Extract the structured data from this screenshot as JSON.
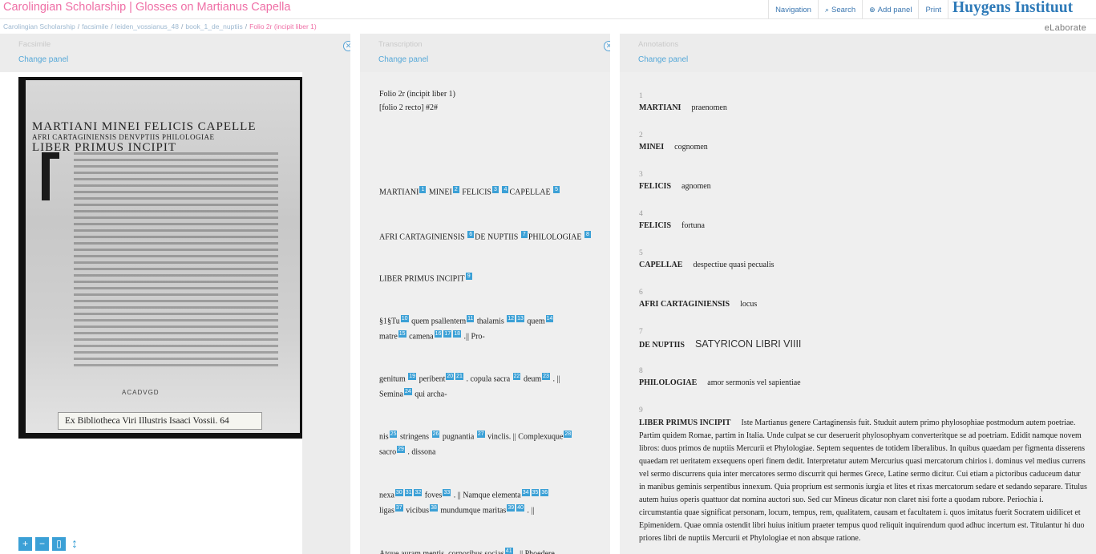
{
  "app_title": "Carolingian Scholarship | Glosses on Martianus Capella",
  "nav": {
    "navigation": "Navigation",
    "search": "Search",
    "add_panel": "Add panel",
    "print": "Print",
    "search_icon": "magnifier-icon",
    "add_icon": "plus-circle-icon"
  },
  "brand": "Huygens Instituut",
  "brand_sub": "eLaborate",
  "breadcrumb": [
    "Carolingian Scholarship",
    "facsimile",
    "leiden_vossianus_48",
    "book_1_de_nuptiis",
    "Folio 2r (incipit liber 1)"
  ],
  "panels": {
    "facsimile": {
      "title": "Facsimile",
      "change": "Change panel",
      "ms_heading": "MARTIANI MINEI FELICIS CAPELLE",
      "ms_heading2": "AFRI CARTAGINIENSIS DENVPTIIS PHILOLOGIAE",
      "ms_heading3": "LIBER PRIMUS INCIPIT",
      "ms_stamp": "ACADVGD",
      "ex_label": "Ex Bibliotheca Viri Illustris Isaaci Vossii. 64"
    },
    "transcription": {
      "title": "Transcription",
      "change": "Change panel",
      "header1": "Folio 2r (incipit liber 1)",
      "header2": "[folio 2 recto] #2#"
    },
    "annotations": {
      "title": "Annotations",
      "change": "Change panel"
    }
  },
  "annotations": [
    {
      "n": "1",
      "term": "MARTIANI",
      "text": "praenomen"
    },
    {
      "n": "2",
      "term": "MINEI",
      "text": "cognomen"
    },
    {
      "n": "3",
      "term": "FELICIS",
      "text": "agnomen"
    },
    {
      "n": "4",
      "term": "FELICIS",
      "text": "fortuna"
    },
    {
      "n": "5",
      "term": "CAPELLAE",
      "text": "despectiue quasi pecualis"
    },
    {
      "n": "6",
      "term": "AFRI CARTAGINIENSIS",
      "text": "locus"
    },
    {
      "n": "7",
      "term": "DE NUPTIIS",
      "text": "SATYRICON LIBRI VIIII"
    },
    {
      "n": "8",
      "term": "PHILOLOGIAE",
      "text": "amor sermonis vel sapientiae"
    },
    {
      "n": "9",
      "term": "LIBER PRIMUS INCIPIT",
      "text": "Iste Martianus genere Cartaginensis fuit. Studuit autem primo phylosophiae postmodum autem poetriae. Partim quidem Romae, partim in Italia. Unde culpat se cur deseruerit phylosophyam converteritque se ad poetriam. Edidit namque novem libros: duos primos de nuptiis Mercurii et Phylologiae. Septem sequentes de totidem liberalibus. In quibus quaedam per figmenta disserens quaedam ret ueritatem exsequens operi finem dedit. Interpretatur autem Mercurius quasi mercatorum chirios i. dominus vel medius currens vel sermo discurrens quia inter mercatores sermo discurrit qui hermes Grece, Latine sermo dicitur. Cui etiam a pictoribus caduceum datur in manibus geminis serpentibus innexum. Quia proprium est sermonis iurgia et lites et rixas mercatorum sedare et sedando separare. Titulus autem huius operis quattuor dat nomina auctori suo. Sed cur Mineus dicatur non claret nisi forte a quodam rubore. Periochia i. circumstantia quae significat personam, locum, tempus, rem, qualitatem, causam et facultatem i. quos imitatus fuerit Socratem uidilicet et Epimenidem. Quae omnia ostendit libri huius initium praeter tempus quod reliquit inquirendum quod adhuc incertum est. Titulantur hi duo priores libri de nuptiis Mercurii et Phylologiae et non absque ratione."
    }
  ],
  "transcription_lines": [
    {
      "segments": [
        [
          "MARTIANI",
          [
            "1"
          ]
        ],
        [
          " MINEI",
          [
            "2"
          ]
        ],
        [
          " FELICIS",
          [
            "3"
          ]
        ],
        [
          " ",
          [
            "4"
          ]
        ],
        [
          "CAPELLAE ",
          [
            "5"
          ]
        ]
      ]
    },
    {
      "segments": [
        [
          "AFRI CARTAGINIENSIS ",
          [
            "6"
          ]
        ],
        [
          "DE NUPTIIS ",
          [
            "7"
          ]
        ],
        [
          "PHILOLOGIAE ",
          [
            "8"
          ]
        ]
      ]
    },
    {
      "segments": [
        [
          "LIBER PRIMUS INCIPIT",
          [
            "9"
          ]
        ]
      ]
    },
    {
      "segments": [
        [
          "§1§Tu",
          [
            "10"
          ]
        ],
        [
          " quem psallentem",
          [
            "11"
          ]
        ],
        [
          " thalamis ",
          [
            "12",
            "13"
          ]
        ],
        [
          " quem",
          [
            "14"
          ]
        ]
      ]
    },
    {
      "segments": [
        [
          "matre",
          [
            "15"
          ]
        ],
        [
          " camena",
          [
            "16",
            "17",
            "18"
          ]
        ],
        [
          " .|| Pro-",
          []
        ]
      ]
    },
    {
      "segments": [
        [
          "genitum ",
          [
            "19"
          ]
        ],
        [
          " peribent",
          [
            "20",
            "21"
          ]
        ],
        [
          " . copula sacra ",
          [
            "22"
          ]
        ],
        [
          " deum",
          [
            "23"
          ]
        ],
        [
          " . ||",
          []
        ]
      ]
    },
    {
      "segments": [
        [
          "Semina",
          [
            "24"
          ]
        ],
        [
          " qui archa-",
          []
        ]
      ]
    },
    {
      "segments": [
        [
          "nis",
          [
            "25"
          ]
        ],
        [
          " stringens ",
          [
            "26"
          ]
        ],
        [
          " pugnantia ",
          [
            "27"
          ]
        ],
        [
          " vinclis. || Complexuque",
          [
            "28"
          ]
        ]
      ]
    },
    {
      "segments": [
        [
          "sacro",
          [
            "29"
          ]
        ],
        [
          " . dissona",
          []
        ]
      ]
    },
    {
      "segments": [
        [
          "nexa",
          [
            "30",
            "31",
            "32"
          ]
        ],
        [
          " foves",
          [
            "33"
          ]
        ],
        [
          " . || Namque elementa",
          [
            "34",
            "35",
            "36"
          ]
        ]
      ]
    },
    {
      "segments": [
        [
          "ligas",
          [
            "37"
          ]
        ],
        [
          " vicibus",
          [
            "38"
          ]
        ],
        [
          " mundumque maritas",
          [
            "39",
            "40"
          ]
        ],
        [
          " . ||",
          []
        ]
      ]
    },
    {
      "segments": [
        [
          "Atque auram mentis, corporibus socias",
          [
            "41"
          ]
        ],
        [
          " . || Phoedere",
          []
        ]
      ]
    }
  ]
}
